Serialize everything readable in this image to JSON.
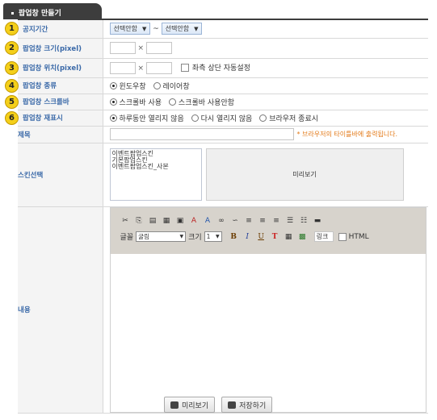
{
  "header": {
    "title": "팝업창 만들기"
  },
  "rows": {
    "period": {
      "number": "1",
      "label": "공지기간",
      "start_select": "선택안함",
      "separator": "~",
      "end_select": "선택안함"
    },
    "size": {
      "number": "2",
      "label": "팝업창 크기(pixel)",
      "x": "×"
    },
    "position": {
      "number": "3",
      "label": "팝업창 위치(pixel)",
      "x": "×",
      "auto_label": "좌측 상단 자동설정"
    },
    "type": {
      "number": "4",
      "label": "팝업창 종류",
      "options": [
        "윈도우창",
        "레이어창"
      ]
    },
    "scroll": {
      "number": "5",
      "label": "팝업창 스크롤바",
      "options": [
        "스크롤바 사용",
        "스크롤바 사용안함"
      ]
    },
    "redisplay": {
      "number": "6",
      "label": "팝업창 재표시",
      "options": [
        "하루동안 열리지 않음",
        "다시 열리지 않음",
        "브라우저 종료시"
      ]
    },
    "subject": {
      "label": "제목",
      "hint": "* 브라우저의 타이틀바에 출력됩니다."
    },
    "skin": {
      "label": "스킨선택",
      "items": [
        "이벤트팝업스킨",
        "기본팝업스킨",
        "이벤트팝업스킨_사본"
      ],
      "preview_label": "미리보기"
    },
    "content": {
      "label": "내용"
    }
  },
  "editor": {
    "font_label": "글꼴",
    "font_value": "굴림",
    "size_label": "크기",
    "size_value": "1",
    "link_label": "링크",
    "html_label": "HTML"
  },
  "buttons": {
    "preview": "미리보기",
    "save": "저장하기"
  }
}
